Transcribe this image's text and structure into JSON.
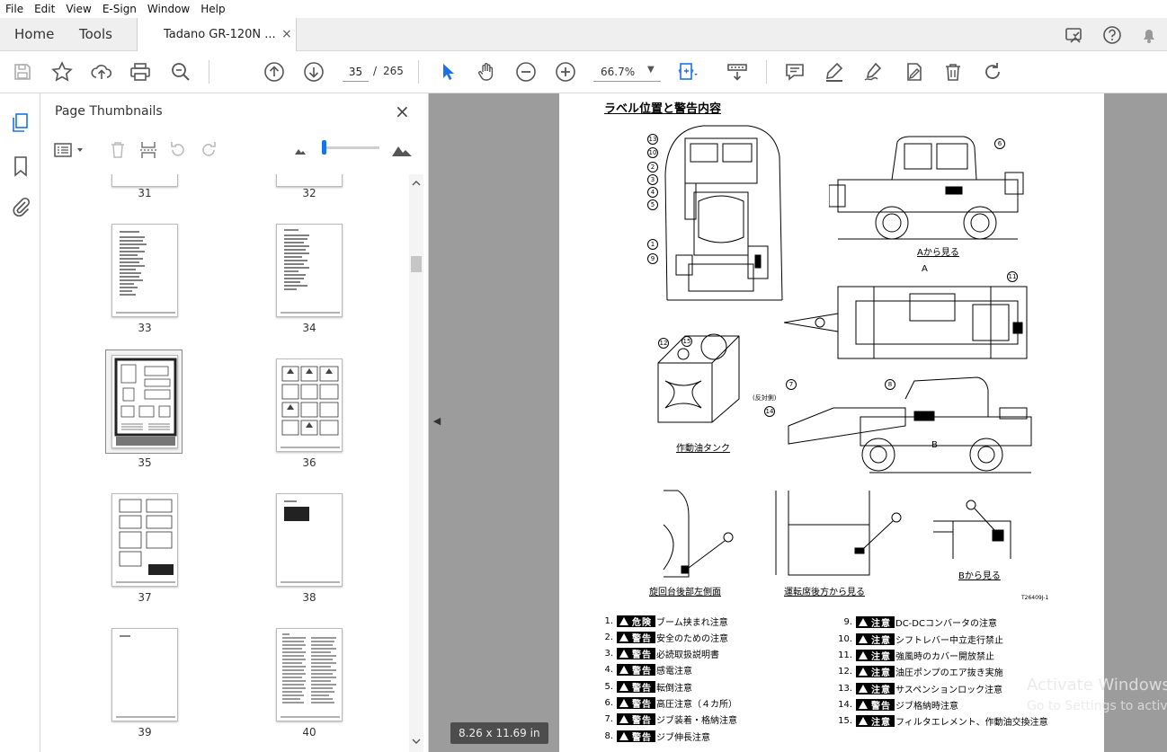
{
  "menu": [
    "File",
    "Edit",
    "View",
    "E-Sign",
    "Window",
    "Help"
  ],
  "tabs": {
    "home": "Home",
    "tools": "Tools",
    "document": "Tadano GR-120N ...",
    "close": "×"
  },
  "toolbar": {
    "page_current": "35",
    "page_separator": "/",
    "page_total": "265",
    "zoom": "66.7%"
  },
  "icons": {
    "toolbar": [
      "save-icon",
      "bookmark-star-icon",
      "upload-icon",
      "print-icon",
      "zoom-search-icon",
      "page-up-icon",
      "page-down-icon",
      "select-arrow-icon",
      "hand-pan-icon",
      "zoom-out-icon",
      "zoom-in-icon",
      "fit-page-icon",
      "scroll-mode-icon",
      "comment-icon",
      "highlight-pen-icon",
      "draw-icon",
      "sign-icon",
      "delete-icon",
      "rotate-icon"
    ],
    "header_right": [
      "share-screen-icon",
      "help-icon",
      "notification-bell-icon"
    ],
    "left_rail": [
      "page-thumbnails-icon",
      "bookmarks-icon",
      "attachments-icon"
    ]
  },
  "sidebar": {
    "title": "Page Thumbnails",
    "close": "×",
    "thumbnails": [
      {
        "label": "31"
      },
      {
        "label": "32"
      },
      {
        "label": "33"
      },
      {
        "label": "34"
      },
      {
        "label": "35",
        "selected": true
      },
      {
        "label": "36"
      },
      {
        "label": "37"
      },
      {
        "label": "38"
      },
      {
        "label": "39"
      },
      {
        "label": "40"
      }
    ]
  },
  "document": {
    "page_size": "8.26 x 11.69 in",
    "page": {
      "title": "ラベル位置と警告内容",
      "captions": {
        "view_a": "Aから見る",
        "tank": "作動油タンク",
        "rear_left": "旋回台後部左側面",
        "cab_rear": "運転席後方から見る",
        "view_b": "Bから見る",
        "reverse_side": "(反対側)",
        "arrow_a": "A",
        "arrow_b": "B"
      },
      "callouts": [
        "13",
        "10",
        "2",
        "3",
        "4",
        "5",
        "1",
        "9",
        "6",
        "11",
        "12",
        "15",
        "7",
        "14",
        "8"
      ],
      "code": "T26409J-1",
      "labels": [
        {
          "num": "1.",
          "level": "危険",
          "text": "ブーム挟まれ注意"
        },
        {
          "num": "2.",
          "level": "警告",
          "text": "安全のための注意"
        },
        {
          "num": "3.",
          "level": "警告",
          "text": "必読取扱説明書"
        },
        {
          "num": "4.",
          "level": "警告",
          "text": "感電注意"
        },
        {
          "num": "5.",
          "level": "警告",
          "text": "転倒注意"
        },
        {
          "num": "6.",
          "level": "警告",
          "text": "高圧注意（４カ所）"
        },
        {
          "num": "7.",
          "level": "警告",
          "text": "ジブ装着・格納注意"
        },
        {
          "num": "8.",
          "level": "警告",
          "text": "ジブ伸長注意"
        },
        {
          "num": "9.",
          "level": "注意",
          "text": "DC-DCコンバータの注意"
        },
        {
          "num": "10.",
          "level": "注意",
          "text": "シフトレバー中立走行禁止"
        },
        {
          "num": "11.",
          "level": "注意",
          "text": "強風時のカバー開放禁止"
        },
        {
          "num": "12.",
          "level": "注意",
          "text": "油圧ポンプのエア抜き実施"
        },
        {
          "num": "13.",
          "level": "注意",
          "text": "サスペンションロック注意"
        },
        {
          "num": "14.",
          "level": "警告",
          "text": "ジブ格納時注意"
        },
        {
          "num": "15.",
          "level": "注意",
          "text": "フィルタエレメント、作動油交換注意"
        }
      ]
    }
  },
  "os_watermark": {
    "line1": "Activate Windows",
    "line2": "Go to Settings to activate"
  }
}
